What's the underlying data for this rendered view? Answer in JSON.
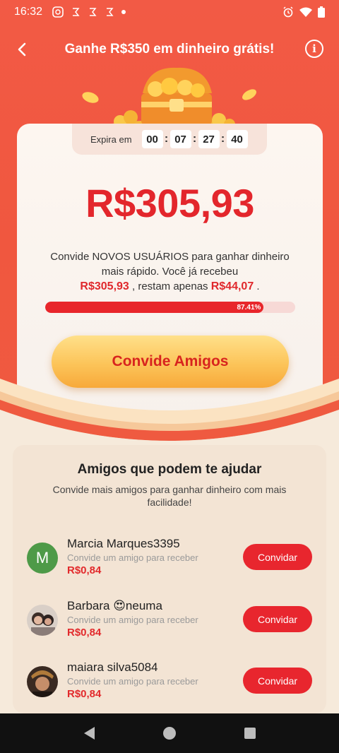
{
  "status_bar": {
    "time": "16:32"
  },
  "header": {
    "title": "Ganhe R$350 em dinheiro grátis!"
  },
  "timer": {
    "label": "Expira em",
    "hours": "00",
    "minutes": "07",
    "seconds": "27",
    "centis": "40"
  },
  "reward": {
    "amount": "R$305,93",
    "desc_line": "Convide NOVOS USUÁRIOS para ganhar dinheiro mais rápido. Você já recebeu",
    "received": "R$305,93",
    "middle": ", restam apenas",
    "remaining": "R$44,07",
    "end": ".",
    "progress_label": "87.41%",
    "progress_value": 87.41
  },
  "invite_button": "Convide Amigos",
  "friends": {
    "title": "Amigos que podem te ajudar",
    "subtitle": "Convide mais amigos para ganhar dinheiro com mais facilidade!",
    "items": [
      {
        "name": "Marcia Marques3395",
        "hint": "Convide um amigo para receber",
        "value": "R$0,84",
        "button": "Convidar",
        "initial": "M"
      },
      {
        "name": "Barbara 😍neuma",
        "hint": "Convide um amigo para receber",
        "value": "R$0,84",
        "button": "Convidar"
      },
      {
        "name": "maiara silva5084",
        "hint": "Convide um amigo para receber",
        "value": "R$0,84",
        "button": "Convidar"
      }
    ]
  },
  "colors": {
    "brand_red": "#e8262e",
    "header_red": "#f0573f",
    "gold": "#fcc459"
  }
}
